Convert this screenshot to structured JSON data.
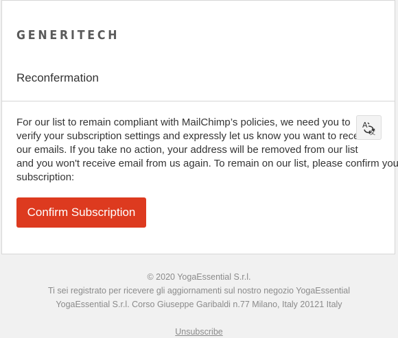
{
  "header": {
    "logo_text": "GENERITECH"
  },
  "content": {
    "heading": "Reconfermation",
    "body_lines": [
      "For our list to remain compliant with MailChimp’s policies, we need you to",
      "verify your subscription settings and expressly let us know you want to receive",
      "our emails. If you take no action, your address will be removed from our list",
      "and you won't receive email from us again. To remain on our list, please confirm your",
      "subscription:"
    ],
    "confirm_label": "Confirm Subscription",
    "translate_icon": "translate-icon"
  },
  "footer": {
    "copyright": "© 2020 YogaEssential S.r.l.",
    "reason": "Ti sei registrato per ricevere gli aggiornamenti sul nostro negozio YogaEssential",
    "address": "YogaEssential S.r.l. Corso Giuseppe Garibaldi n.77 Milano, Italy 20121 Italy",
    "unsubscribe_label": "Unsubscribe"
  },
  "colors": {
    "accent": "#dd3a1f",
    "background": "#f1f1f1",
    "card": "#ffffff",
    "text": "#333333",
    "muted": "#8a8a8a"
  }
}
